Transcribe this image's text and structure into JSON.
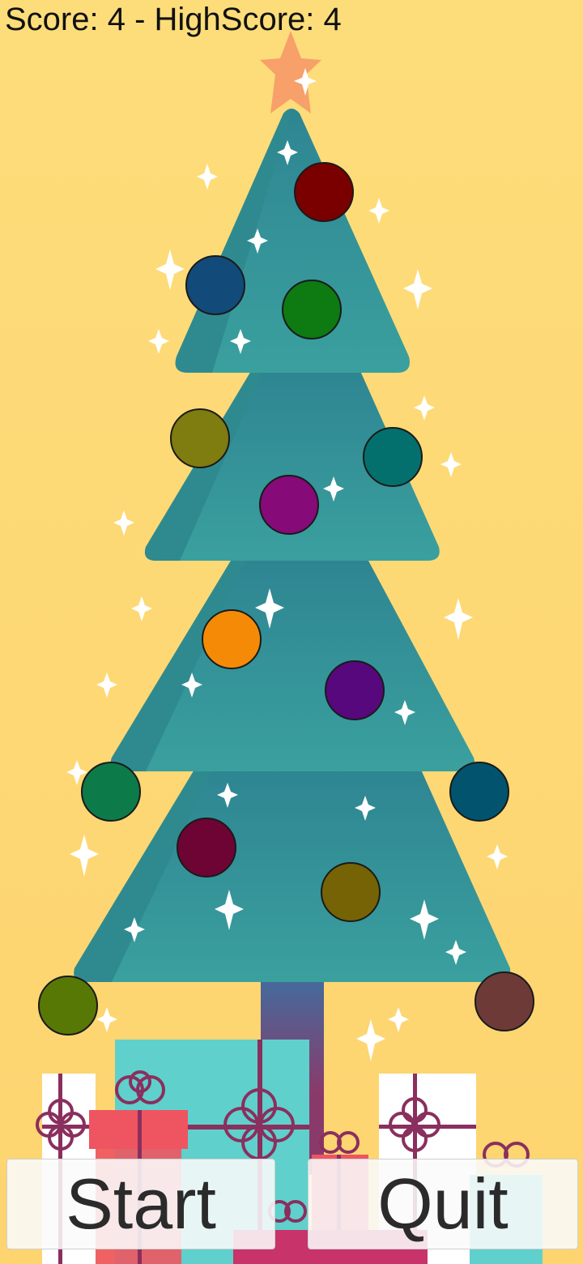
{
  "hud": {
    "score_text": "Score: 4 - HighScore: 4"
  },
  "buttons": {
    "start_label": "Start",
    "quit_label": "Quit"
  },
  "colors": {
    "background": "#fdd876",
    "tree": "#3a9a9e",
    "tree_shade": "#2f8a90",
    "trunk": "#8a3a6a",
    "star": "#f7a06a",
    "gift_teal": "#5fd0cc",
    "gift_red": "#ee5560",
    "gift_white": "#ffffff",
    "ribbon": "#8a2f5e"
  },
  "ornaments": [
    {
      "color": "#7a0000"
    },
    {
      "color": "#124a7a"
    },
    {
      "color": "#0d7a12"
    },
    {
      "color": "#7f7c10"
    },
    {
      "color": "#04706e"
    },
    {
      "color": "#860a78"
    },
    {
      "color": "#f58a06"
    },
    {
      "color": "#56087c"
    },
    {
      "color": "#0d7a4a"
    },
    {
      "color": "#02536e"
    },
    {
      "color": "#6e0434"
    },
    {
      "color": "#756306"
    },
    {
      "color": "#587806"
    },
    {
      "color": "#6e3a38"
    }
  ]
}
